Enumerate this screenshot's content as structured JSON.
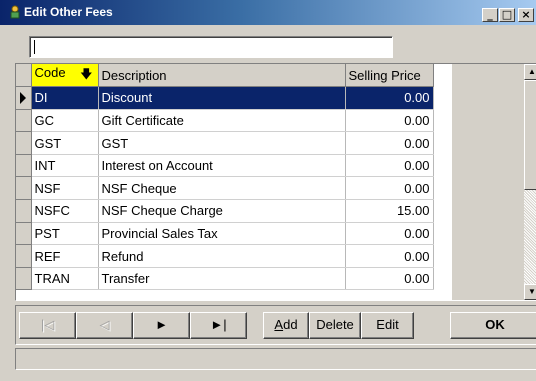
{
  "window": {
    "title": "Edit Other Fees"
  },
  "search": {
    "value": ""
  },
  "grid": {
    "columns": [
      "Code",
      "Description",
      "Selling Price"
    ],
    "selected_index": 0,
    "rows": [
      {
        "code": "DI",
        "description": "Discount",
        "price": "0.00"
      },
      {
        "code": "GC",
        "description": "Gift Certificate",
        "price": "0.00"
      },
      {
        "code": "GST",
        "description": "GST",
        "price": "0.00"
      },
      {
        "code": "INT",
        "description": "Interest on Account",
        "price": "0.00"
      },
      {
        "code": "NSF",
        "description": "NSF Cheque",
        "price": "0.00"
      },
      {
        "code": "NSFC",
        "description": "NSF Cheque Charge",
        "price": "15.00"
      },
      {
        "code": "PST",
        "description": "Provincial Sales Tax",
        "price": "0.00"
      },
      {
        "code": "REF",
        "description": "Refund",
        "price": "0.00"
      },
      {
        "code": "TRAN",
        "description": "Transfer",
        "price": "0.00"
      }
    ]
  },
  "nav": {
    "first_icon": "first-record-icon",
    "prev_icon": "previous-record-icon",
    "next_icon": "next-record-icon",
    "last_icon": "last-record-icon",
    "add_mnemonic": "A",
    "add_rest": "dd",
    "delete": "Delete",
    "edit": "Edit",
    "ok": "OK"
  },
  "colors": {
    "title_start": "#0a246a",
    "title_end": "#a6caf0",
    "selection": "#0a246a",
    "code_header": "#ffff00"
  }
}
